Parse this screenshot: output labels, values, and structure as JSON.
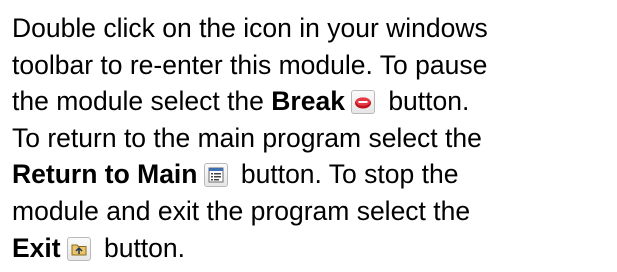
{
  "text": {
    "l1": "Double click on the icon in your windows",
    "l2": "toolbar to re-enter this module.  To pause",
    "l3_pre": "the module select the ",
    "break_label": "Break",
    "l3_post": " button.",
    "l4": "To return to the main program select the",
    "return_label": "Return to Main",
    "l5_post": " button.  To stop the",
    "l6": "module and exit the program select the",
    "exit_label": "Exit",
    "l7_post": " button."
  },
  "icons": {
    "break": "stop-sign-icon",
    "return_to_main": "document-list-icon",
    "exit": "folder-exit-icon"
  },
  "colors": {
    "text": "#000000",
    "break_icon": "#c1121f",
    "icon_frame": "#b9b9b9"
  }
}
